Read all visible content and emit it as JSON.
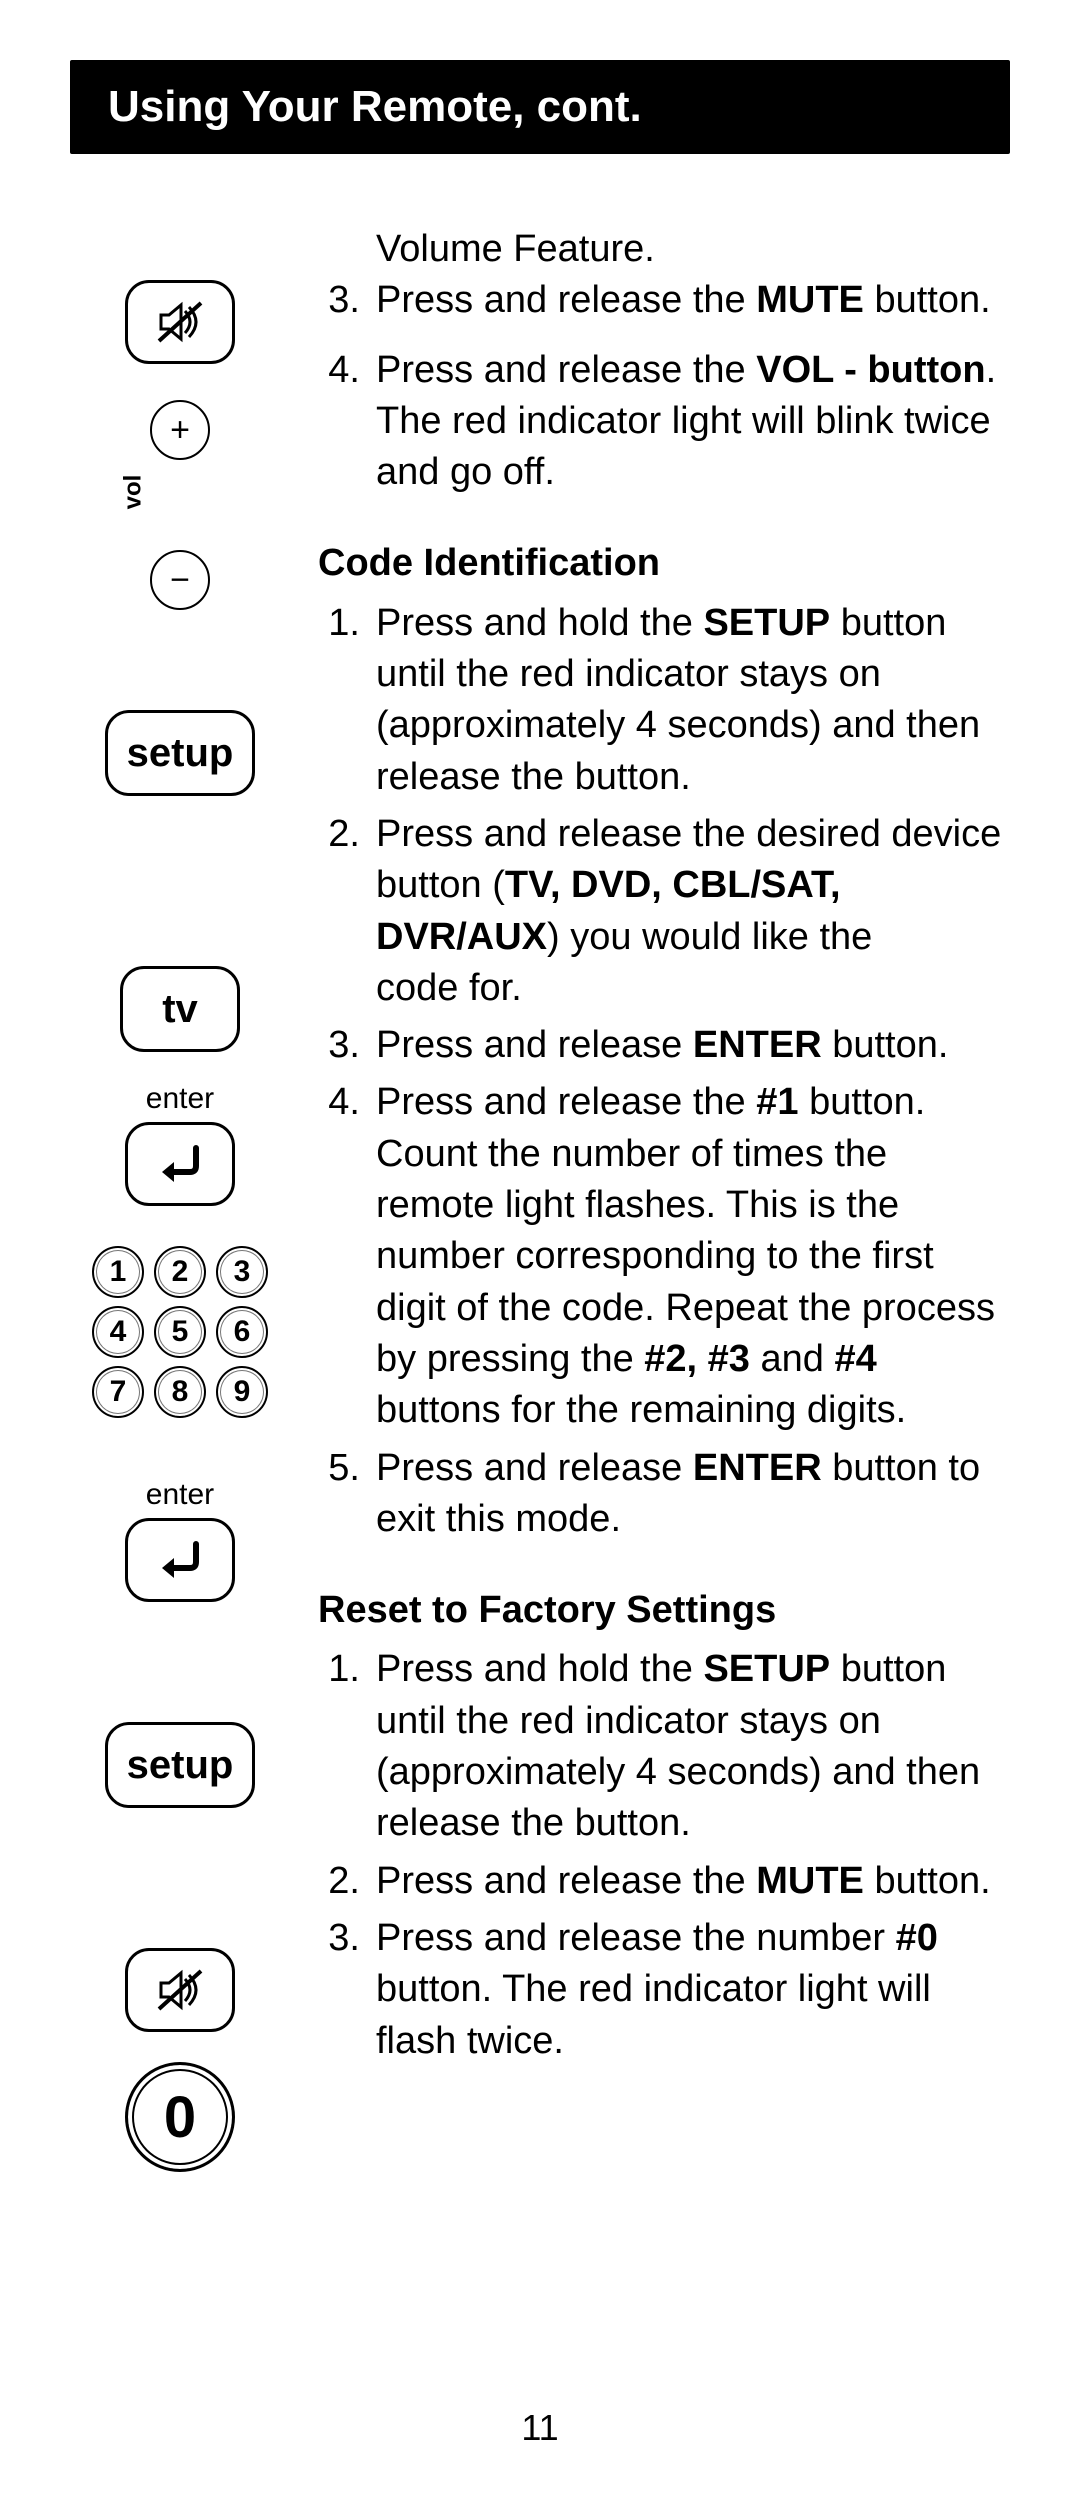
{
  "title": "Using Your Remote, cont.",
  "page_number": "11",
  "icons": {
    "mute": "mute-icon",
    "plus": "+",
    "minus": "−",
    "vol_label": "vol",
    "setup": "setup",
    "tv": "tv",
    "enter_label": "enter",
    "keypad": [
      "1",
      "2",
      "3",
      "4",
      "5",
      "6",
      "7",
      "8",
      "9"
    ],
    "zero": "0"
  },
  "text": {
    "vol_feature": "Volume Feature.",
    "step3_pre": "Press and release the ",
    "step3_bold": "MUTE",
    "step3_post": " button.",
    "step4_pre": "Press and release the ",
    "step4_bold": "VOL - button",
    "step4_post": ". The red indicator light will blink twice and go off.",
    "code_id_head": "Code Identification",
    "ci1_pre": "Press and hold the ",
    "ci1_bold": "SETUP",
    "ci1_post": " button until the red indicator stays on (approximately 4 seconds) and then release the button.",
    "ci2_pre": "Press and release the desired device button (",
    "ci2_bold": "TV, DVD, CBL/SAT, DVR/AUX",
    "ci2_post": ") you would like the",
    "ci2_tail": "code for.",
    "ci3_pre": "Press and release ",
    "ci3_bold": "ENTER",
    "ci3_post": " button.",
    "ci4_pre": "Press and release the ",
    "ci4_bold1": "#1",
    "ci4_mid": " button. Count the number of times the remote light flashes. This is the number corresponding to the first digit of the code. Repeat the process by pressing the ",
    "ci4_bold2": "#2, #3",
    "ci4_and": " and ",
    "ci4_bold3": "#4",
    "ci4_post": " buttons for the remaining digits.",
    "ci5_pre": "Press and release ",
    "ci5_bold": "ENTER",
    "ci5_post": " button to exit this mode.",
    "reset_head": "Reset to Factory Settings",
    "r1_pre": "Press and hold the ",
    "r1_bold": "SETUP",
    "r1_post": " button until the red indicator stays on (approximately 4 seconds) and then release the button.",
    "r2_pre": "Press and release the ",
    "r2_bold": "MUTE",
    "r2_post": " button.",
    "r3_pre": "Press and release the number ",
    "r3_bold": "#0",
    "r3_post": " button. The red indicator light will flash twice."
  }
}
